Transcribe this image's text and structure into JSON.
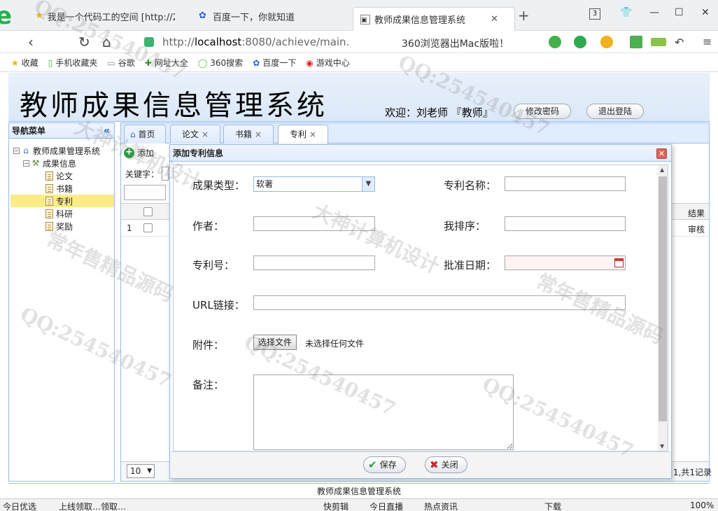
{
  "browser": {
    "tabs": [
      {
        "label": "我是一个代码工的空间 [http://2…"
      },
      {
        "label": "百度一下，你就知道"
      },
      {
        "label": "教师成果信息管理系统"
      }
    ],
    "tab_count": "3",
    "url_prefix": "http://",
    "url_host": "localhost",
    "url_rest": ":8080/achieve/main.",
    "ad_text": "360浏览器出Mac版啦！",
    "bookmarks": [
      {
        "label": "收藏"
      },
      {
        "label": "手机收藏夹"
      },
      {
        "label": "谷歌"
      },
      {
        "label": "网址大全"
      },
      {
        "label": "360搜索"
      },
      {
        "label": "百度一下"
      },
      {
        "label": "游戏中心"
      }
    ]
  },
  "header": {
    "title": "教师成果信息管理系统",
    "welcome": "欢迎：刘老师 『教师』",
    "change_password": "修改密码",
    "logout": "退出登陆"
  },
  "nav": {
    "title": "导航菜单",
    "root": "教师成果管理系统",
    "group": "成果信息",
    "items": [
      {
        "label": "论文"
      },
      {
        "label": "书籍"
      },
      {
        "label": "专利"
      },
      {
        "label": "科研"
      },
      {
        "label": "奖励"
      }
    ]
  },
  "content_tabs": [
    {
      "label": "首页"
    },
    {
      "label": "论文"
    },
    {
      "label": "书籍"
    },
    {
      "label": "专利"
    }
  ],
  "toolbar": {
    "add": "添加",
    "keyword_label": "关键字："
  },
  "grid": {
    "result_col": "结果",
    "row_num": "1",
    "row_status": "审核",
    "page_size": "10",
    "pager_info": "1,共1记录"
  },
  "dialog": {
    "title": "添加专利信息",
    "fields": {
      "type_label": "成果类型：",
      "type_value": "软著",
      "name_label": "专利名称：",
      "author_label": "作者：",
      "rank_label": "我排序：",
      "number_label": "专利号：",
      "date_label": "批准日期：",
      "url_label": "URL链接：",
      "attachment_label": "附件：",
      "file_button": "选择文件",
      "file_status": "未选择任何文件",
      "remark_label": "备注："
    },
    "save": "保存",
    "close": "关闭"
  },
  "footer": {
    "text": "教师成果信息管理系统"
  },
  "statusbar": {
    "left1": "今日优选",
    "left2": "上线领取…领取…",
    "items": [
      "快剪辑",
      "今日直播",
      "热点资讯",
      "下载"
    ],
    "zoom": "100%"
  },
  "watermarks": [
    "QQ:254540457",
    "大神计算机设计",
    "常年售精品源码"
  ]
}
